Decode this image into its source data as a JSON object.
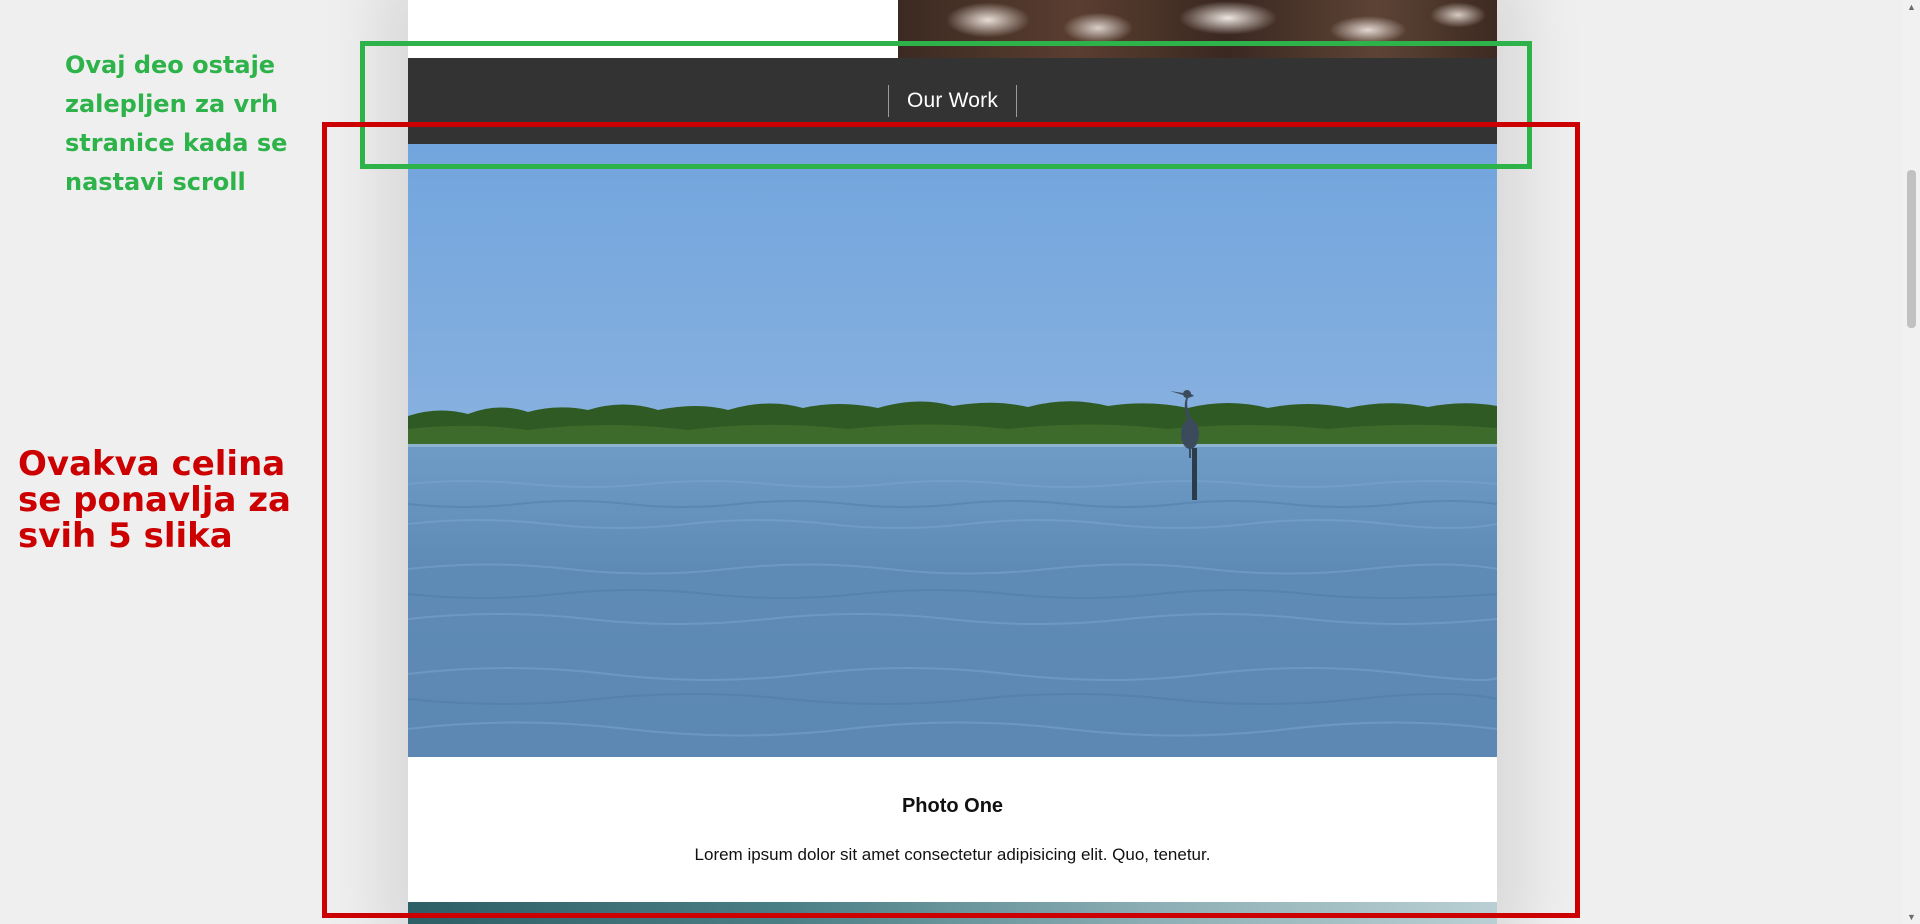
{
  "navbar": {
    "link_label": "Our Work"
  },
  "photo_card": {
    "title": "Photo One",
    "description": "Lorem ipsum dolor sit amet consectetur adipisicing elit. Quo, tenetur."
  },
  "annotations": {
    "green_note": "Ovaj deo ostaje zalepljen za vrh stranice kada se nastavi scroll",
    "red_note": "Ovakva celina se ponavlja za svih 5 slika",
    "green_color": "#2db34a",
    "red_color": "#cc0000"
  },
  "colors": {
    "navbar_bg": "#333333",
    "page_bg": "#efefef"
  },
  "scrollbar": {
    "up_icon": "triangle-up-icon",
    "down_icon": "triangle-down-icon"
  }
}
